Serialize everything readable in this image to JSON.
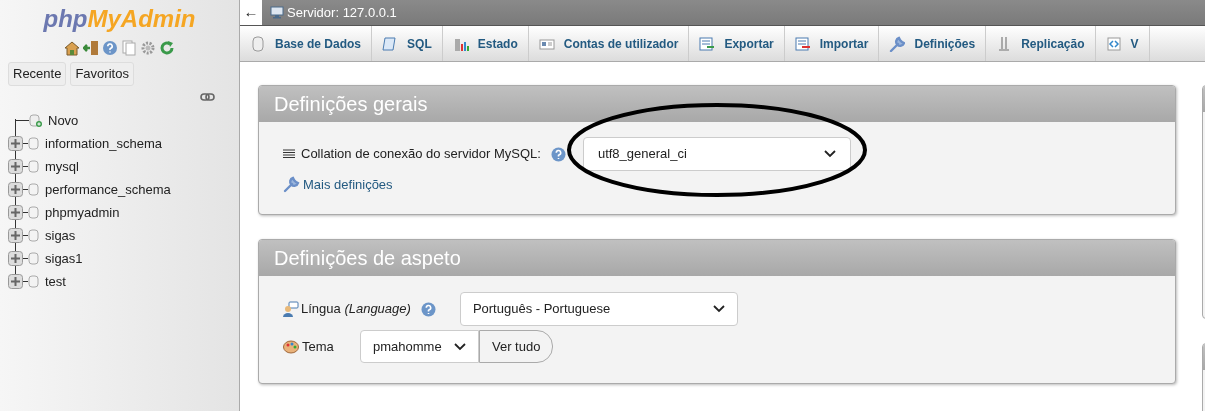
{
  "logo": {
    "part1": "php",
    "part2": "MyAdmin"
  },
  "sidebar": {
    "tabs": [
      "Recente",
      "Favoritos"
    ],
    "tree": [
      {
        "label": "Novo",
        "kind": "new"
      },
      {
        "label": "information_schema",
        "kind": "db",
        "expanded": false
      },
      {
        "label": "mysql",
        "kind": "db",
        "expanded": false
      },
      {
        "label": "performance_schema",
        "kind": "db",
        "expanded": false
      },
      {
        "label": "phpmyadmin",
        "kind": "db",
        "expanded": false
      },
      {
        "label": "sigas",
        "kind": "db",
        "expanded": false
      },
      {
        "label": "sigas1",
        "kind": "db",
        "expanded": false
      },
      {
        "label": "test",
        "kind": "db",
        "expanded": false
      }
    ]
  },
  "topbar": {
    "collapse": "←",
    "title": "Servidor: 127.0.0.1"
  },
  "tabs": [
    {
      "label": "Base de Dados",
      "selected": false
    },
    {
      "label": "SQL",
      "selected": false
    },
    {
      "label": "Estado",
      "selected": false
    },
    {
      "label": "Contas de utilizador",
      "selected": false
    },
    {
      "label": "Exportar",
      "selected": false
    },
    {
      "label": "Importar",
      "selected": false
    },
    {
      "label": "Definições",
      "selected": false
    },
    {
      "label": "Replicação",
      "selected": false
    },
    {
      "label": "V",
      "selected": false
    }
  ],
  "general": {
    "title": "Definições gerais",
    "collation_label": "Collation de conexão do servidor MySQL:",
    "collation_value": "utf8_general_ci",
    "more_link": "Mais definições"
  },
  "appearance": {
    "title": "Definições de aspeto",
    "language_label": "Língua *(Language)*",
    "language_value": "Português - Portuguese",
    "theme_label": "Tema",
    "theme_value": "pmahomme",
    "view_all": "Ver tudo"
  },
  "annotation": {
    "kind": "ellipse"
  }
}
